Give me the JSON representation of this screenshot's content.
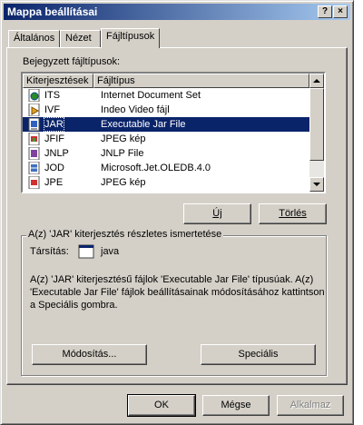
{
  "window": {
    "title": "Mappa beállításai",
    "help_button": "?",
    "close_button": "×"
  },
  "tabs": [
    {
      "label": "Általános"
    },
    {
      "label": "Nézet"
    },
    {
      "label": "Fájltípusok"
    }
  ],
  "registered": {
    "label": "Bejegyzett fájltípusok:",
    "columns": [
      "Kiterjesztések",
      "Fájltípus"
    ],
    "rows": [
      {
        "ext": "ITS",
        "type": "Internet Document Set",
        "icon": "internet-document-icon"
      },
      {
        "ext": "IVF",
        "type": "Indeo Video fájl",
        "icon": "video-file-icon"
      },
      {
        "ext": "JAR",
        "type": "Executable Jar File",
        "icon": "jar-file-icon",
        "selected": true
      },
      {
        "ext": "JFIF",
        "type": "JPEG kép",
        "icon": "image-file-icon"
      },
      {
        "ext": "JNLP",
        "type": "JNLP File",
        "icon": "jnlp-file-icon"
      },
      {
        "ext": "JOD",
        "type": "Microsoft.Jet.OLEDB.4.0",
        "icon": "database-file-icon"
      },
      {
        "ext": "JPE",
        "type": "JPEG kép",
        "icon": "image-file-icon"
      }
    ]
  },
  "buttons": {
    "new": "Új",
    "delete": "Törlés",
    "change": "Módosítás...",
    "advanced": "Speciális",
    "ok": "OK",
    "cancel": "Mégse",
    "apply": "Alkalmaz"
  },
  "details": {
    "group_label": "A(z) 'JAR' kiterjesztés részletes ismertetése",
    "opens_with_label": "Társítás:",
    "opens_with_value": "java",
    "description_line1": "A(z) 'JAR' kiterjesztésű fájlok 'Executable Jar File' típusúak. A(z)",
    "description_line2": "'Executable Jar File' fájlok beállításainak módosításához kattintson",
    "description_line3": "a Speciális gombra."
  }
}
